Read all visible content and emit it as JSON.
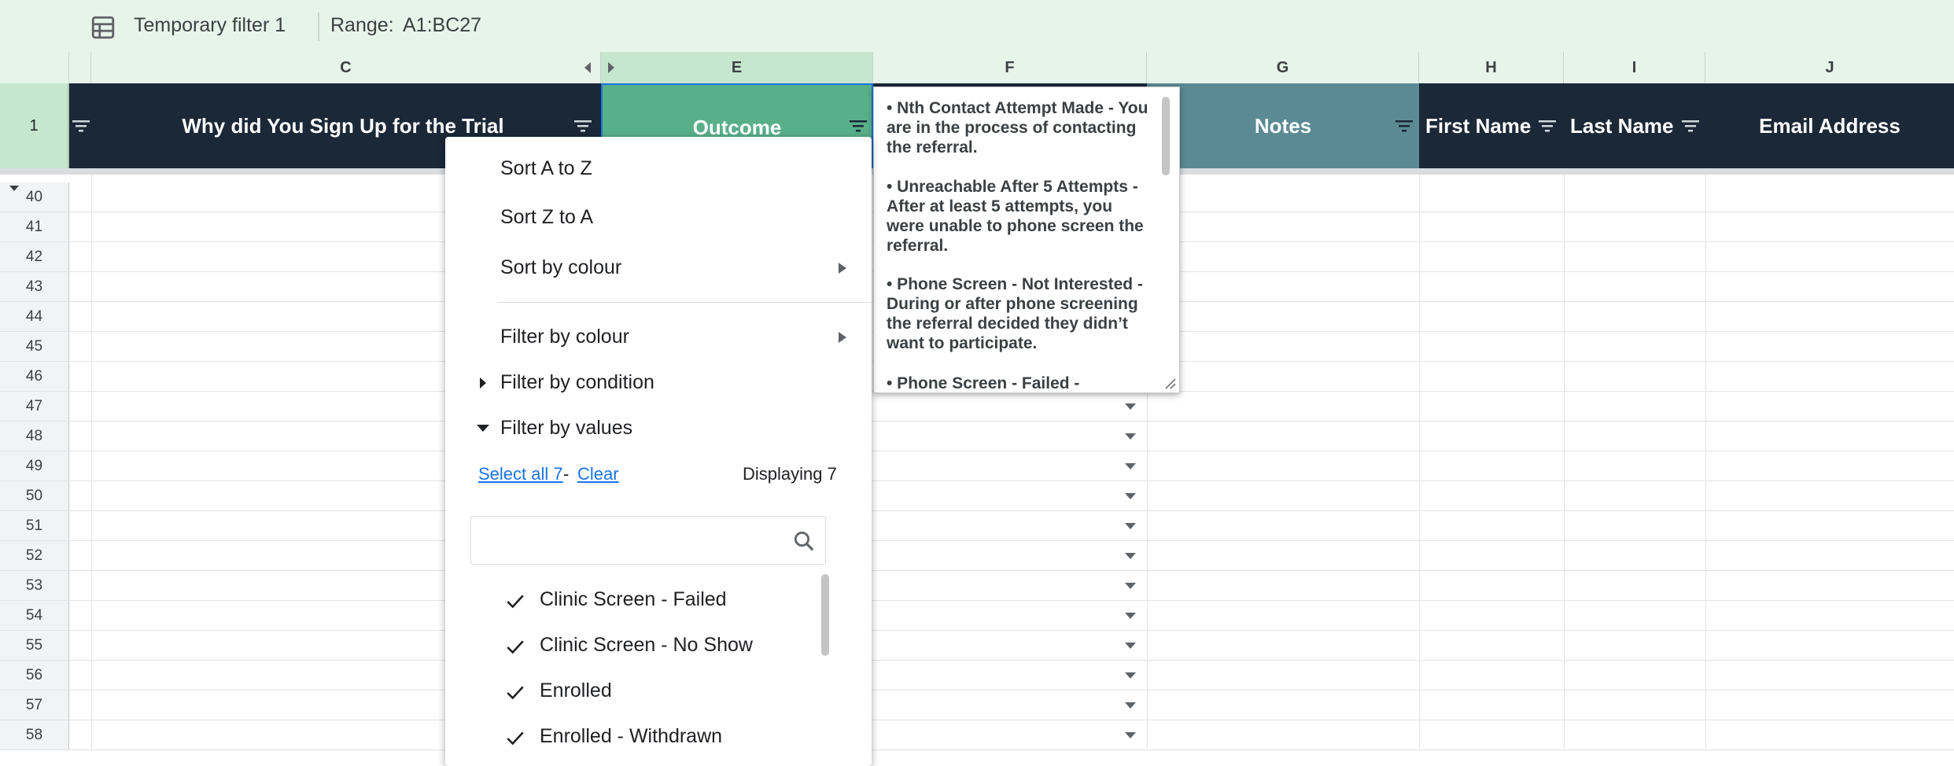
{
  "filter_bar": {
    "name": "Temporary filter 1",
    "range_label": "Range:",
    "range_value": "A1:BC27"
  },
  "columns": [
    "C",
    "E",
    "F",
    "G",
    "H",
    "I",
    "J"
  ],
  "row1_number": "1",
  "headers": {
    "c": "Why did You Sign Up for the Trial",
    "e": "Outcome",
    "g": "Notes",
    "h": "First Name",
    "i": "Last Name",
    "j": "Email Address"
  },
  "rows": [
    "40",
    "41",
    "42",
    "43",
    "44",
    "45",
    "46",
    "47",
    "48",
    "49",
    "50",
    "51",
    "52",
    "53",
    "54",
    "55",
    "56",
    "57",
    "58"
  ],
  "note": {
    "p1": "•      Nth Contact Attempt Made - You are in the process of contacting the referral.",
    "p2": "•      Unreachable After 5 Attempts - After at least 5 attempts, you were unable to phone screen the referral.",
    "p3": "•      Phone Screen - Not Interested - During or after phone screening the referral decided they didn’t want to participate.",
    "p4": "•      Phone Screen - Failed -"
  },
  "menu": {
    "sort_az": "Sort A to Z",
    "sort_za": "Sort Z to A",
    "sort_colour": "Sort by colour",
    "filter_colour": "Filter by colour",
    "filter_condition": "Filter by condition",
    "filter_values": "Filter by values",
    "select_all": "Select all 7",
    "dash": "-",
    "clear": "Clear",
    "displaying": "Displaying 7",
    "search_placeholder": "",
    "values": [
      "Clinic Screen - Failed",
      "Clinic Screen - No Show",
      "Enrolled",
      "Enrolled - Withdrawn"
    ]
  }
}
